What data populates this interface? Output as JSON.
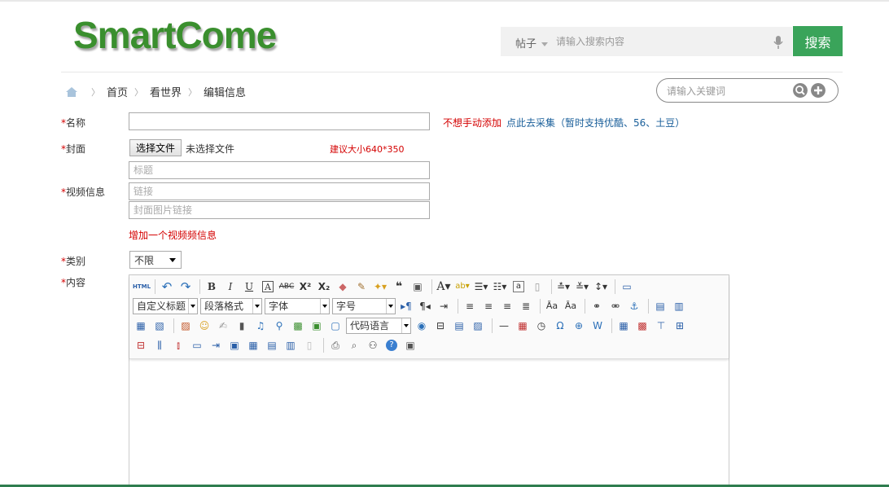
{
  "header": {
    "logo_text": "SmartCome",
    "search_type": "帖子",
    "search_placeholder": "请输入搜索内容",
    "search_button": "搜索"
  },
  "breadcrumb": {
    "items": [
      "首页",
      "看世界",
      "编辑信息"
    ],
    "keyword_placeholder": "请输入关键词"
  },
  "form": {
    "required_mark": "*",
    "name_label": "名称",
    "manual_hint": "不想手动添加",
    "collect_link": "点此去采集（暂时支持优酷、56、土豆）",
    "cover_label": "封面",
    "file_button": "选择文件",
    "file_status": "未选择文件",
    "size_hint": "建议大小640*350",
    "video_label": "视频信息",
    "title_placeholder": "标题",
    "link_placeholder": "链接",
    "cover_link_placeholder": "封面图片链接",
    "add_video": "增加一个视频频信息",
    "category_label": "类别",
    "category_value": "不限",
    "content_label": "内容"
  },
  "editor": {
    "dropdowns": {
      "custom_title": "自定义标题",
      "paragraph": "段落格式",
      "font": "字体",
      "size": "字号",
      "code_lang": "代码语言"
    },
    "html_btn": "HTML"
  },
  "colors": {
    "brand_green": "#3a8f2e",
    "search_green": "#3aa45a",
    "required_red": "#d40000",
    "link_blue": "#1a5f9a"
  }
}
